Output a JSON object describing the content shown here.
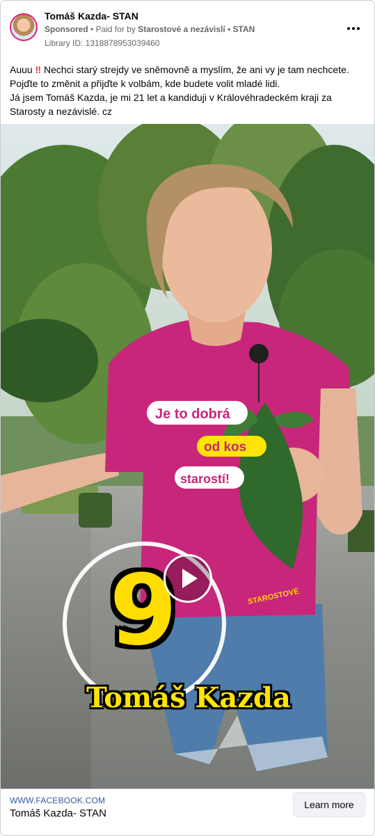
{
  "advertiser": {
    "name": "Tomáš Kazda- STAN",
    "sponsored_label": "Sponsored",
    "paid_for_by_label": "Paid for by",
    "payer": "Starostové a nezávislí • STAN",
    "separator": "•",
    "library_id": "Library ID: 1318878953039460"
  },
  "post": {
    "line1_start": "Auuu",
    "line1_emoji": "‼",
    "line1_rest": " Nechci starý strejdy ve sněmovně a myslím, že ani vy je tam nechcete.",
    "line2": "Pojďte to změnit a přijďte k volbám, kde budete volit mladé lidi.",
    "line3": "Já jsem Tomáš Kazda, je mi 21 let a kandiduji v Královéhradeckém kraji za",
    "line4": "Starosty a nezávislé. cz"
  },
  "video": {
    "candidate_number": "9",
    "caption_name": "Tomáš Kazda",
    "shirt_text_1": "Je to dobrá",
    "shirt_text_2": "od kos",
    "shirt_text_3": "starostí!",
    "shirt_brand": "STAROSTOVÉ",
    "play_icon": "play-icon"
  },
  "link": {
    "domain": "WWW.FACEBOOK.COM",
    "title": "Tomáš Kazda- STAN",
    "cta_label": "Learn more"
  },
  "colors": {
    "shirt": "#c8267a",
    "number_fill": "#ffdd00",
    "caption_fill": "#ffe500",
    "link_domain": "#385898"
  }
}
